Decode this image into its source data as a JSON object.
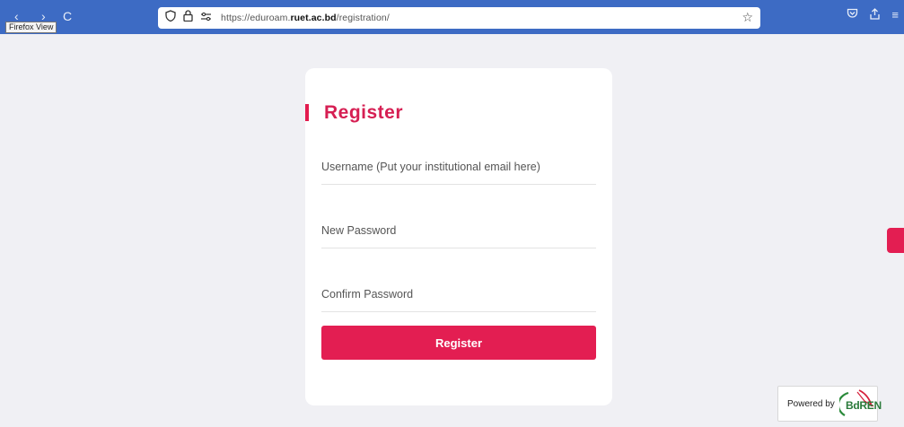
{
  "browser": {
    "tooltip": "Firefox View",
    "reload_glyph": "C",
    "url_prefix": "https://eduroam.",
    "url_domain": "ruet.ac.bd",
    "url_path": "/registration/"
  },
  "form": {
    "title": "Register",
    "username_placeholder": "Username (Put your institutional email here)",
    "password_placeholder": "New Password",
    "confirm_placeholder": "Confirm Password",
    "submit_label": "Register"
  },
  "footer": {
    "powered_by": "Powered by",
    "brand": "BdREN"
  },
  "colors": {
    "toolbar": "#3d6bc4",
    "accent": "#e31e52",
    "title": "#d61f53"
  }
}
